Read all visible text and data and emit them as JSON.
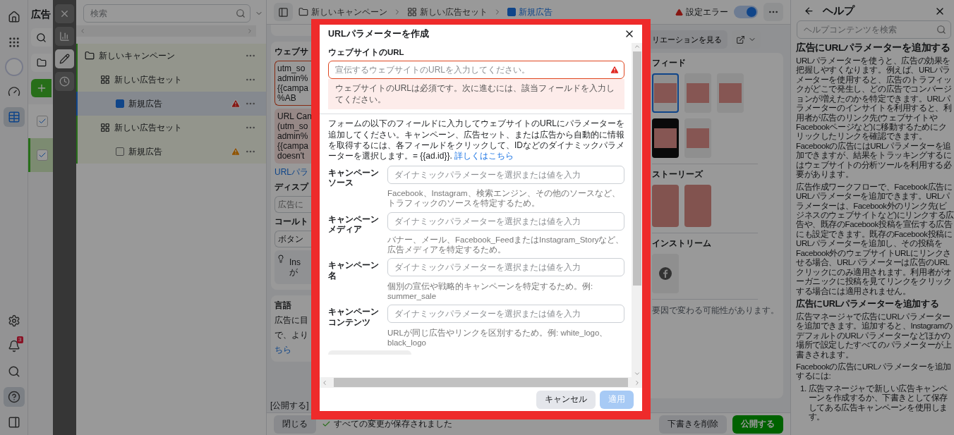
{
  "nav_rail": {
    "items": [
      {
        "kind": "home",
        "selected": false
      },
      {
        "kind": "apps",
        "selected": false
      },
      {
        "kind": "account",
        "selected": false
      },
      {
        "kind": "dashboard",
        "selected": false
      },
      {
        "kind": "table",
        "selected": true
      }
    ],
    "bottom_items": [
      {
        "kind": "settings",
        "selected": false
      },
      {
        "kind": "notifications",
        "selected": false,
        "badge": "3"
      },
      {
        "kind": "search",
        "selected": false
      },
      {
        "kind": "help",
        "selected": true
      },
      {
        "kind": "panel",
        "selected": false
      }
    ]
  },
  "side_panel": {
    "title": "広告",
    "rows": [
      {
        "checked": true,
        "selected": false
      },
      {
        "checked": true,
        "selected": true
      }
    ]
  },
  "tool_strip": {
    "items": [
      {
        "kind": "close",
        "selected": false
      },
      {
        "kind": "chart",
        "selected": false
      },
      {
        "kind": "edit",
        "selected": true
      },
      {
        "kind": "history",
        "selected": false
      }
    ]
  },
  "tree": {
    "search": {
      "placeholder": "検索"
    },
    "items": [
      {
        "kind": "campaign",
        "label": "新しいキャンペーン",
        "selected": false,
        "children": [
          {
            "kind": "ad_set",
            "label": "新しい広告セット",
            "selected": false,
            "children": [
              {
                "kind": "ad",
                "label": "新規広告",
                "selected": true,
                "error": true,
                "warning": false
              }
            ]
          },
          {
            "kind": "ad_set",
            "label": "新しい広告セット",
            "selected": false,
            "children": [
              {
                "kind": "ad",
                "label": "新規広告",
                "selected": false,
                "error": false,
                "warning": true
              }
            ]
          }
        ]
      }
    ]
  },
  "top_bar": {
    "breadcrumbs": [
      {
        "kind": "campaign",
        "label": "新しいキャンペーン",
        "selected": false
      },
      {
        "kind": "ad_set",
        "label": "新しい広告セット",
        "selected": false
      },
      {
        "kind": "ad",
        "label": "新規広告",
        "selected": true
      }
    ],
    "status": "設定エラー",
    "toggle_on": true
  },
  "editor": {
    "website_label": "ウェブサ",
    "url_box_lines": [
      "utm_so",
      "admin%",
      "{{campa",
      "%AB"
    ],
    "url_error_lines": [
      "URL Can",
      "(utm_so",
      "admin%",
      "{{campa",
      "doesn't"
    ],
    "param_link": "URLパラ",
    "display_label": "ディスプ",
    "display_placeholder": "広告に",
    "cta_label": "コールト",
    "cta_value": "ボタン",
    "tip_lines": [
      "Ins",
      "が"
    ],
    "language_title": "言語",
    "language_lines": [
      "広告に目",
      "で、より"
    ],
    "language_link": "ちら"
  },
  "publish_note": "[公開する]",
  "footer": {
    "close": "閉じる",
    "saved": "すべての変更が保存されました",
    "delete_draft": "下書きを削除",
    "publish": "公開する"
  },
  "preview": {
    "variations_button": "リエーションを見る",
    "sections": [
      {
        "title": "フィード",
        "thumbnails": [
          {
            "kind": "feed",
            "selected": true
          },
          {
            "kind": "feed",
            "selected": false
          },
          {
            "kind": "feed",
            "selected": false
          },
          {
            "kind": "feed_dark",
            "selected": false
          },
          {
            "kind": "feed",
            "selected": false
          }
        ]
      },
      {
        "title": "ストーリーズ",
        "thumbnails": [
          {
            "kind": "story",
            "selected": false
          },
          {
            "kind": "story",
            "selected": false
          }
        ]
      },
      {
        "title": "インストリーム",
        "thumbnails": [
          {
            "kind": "instream",
            "selected": false
          }
        ]
      }
    ],
    "note": "要因で変わる可能性があります。"
  },
  "help": {
    "title": "ヘルプ",
    "search": {
      "placeholder": "ヘルプコンテンツを検索"
    },
    "blocks": [
      {
        "kind": "heading",
        "text": "広告にURLパラメーターを追加する"
      },
      {
        "kind": "paragraph",
        "text": "URLパラメーターを使うと、広告の効果を把握しやすくなります。例えば、URLパラメーターを使用すると、広告のトラフィックがどこで発生し、どの広告でコンバージョンが増えたのかを特定できます。URLパラメーターのインサイトを利用すると、利用者が広告のリンク先(ウェブサイトやFacebookページなど)に移動するためにクリックしたリンクを確認できます。Facebookの広告にはURLパラメーターを追加できますが、結果をトラッキングするにはウェブサイトの分析ツールを利用する必要があります。"
      },
      {
        "kind": "paragraph",
        "text": "広告作成ワークフローで、Facebook広告にURLパラメーターを追加できます。URLパラメーターは、Facebook外のリンク先(ビジネスのウェブサイトなど)にリンクする広告や、既存のFacebook投稿を宣伝する広告にも設定できます。既存のFacebook投稿にURLパラメーターを追加し、その投稿をFacebook外のウェブサイトURLにリンクさせる場合、URLパラメーターは広告のURLクリックにのみ適用されます。利用者がオーガニックに投稿を見てリンクをクリックする場合には適用されません。"
      },
      {
        "kind": "subheading",
        "text": "広告にURLパラメーターを追加する"
      },
      {
        "kind": "paragraph",
        "text": "広告マネージャで広告にURLパラメーターを追加できます。追加すると、InstagramのデフォルトのURLパラメーターなどほかの場所で設定したすべてのパラメーターが上書きされます。"
      },
      {
        "kind": "paragraph",
        "text": "Facebookの広告にURLパラメーターを追加するには:"
      },
      {
        "kind": "list_item",
        "marker": "1.",
        "text": "広告マネージャで新しい広告キャンペーンを作成するか、下書きとして保存してある広告キャンペーンを使用します。"
      }
    ]
  },
  "dialog": {
    "title": "URLパラメーターを作成",
    "url_field": {
      "label": "ウェブサイトのURL",
      "placeholder": "宣伝するウェブサイトのURLを入力してください。",
      "error": true,
      "error_message": "ウェブサイトのURLは必須です。次に進むには、該当フィールドを入力してください。"
    },
    "description": "フォームの以下のフィールドに入力してウェブサイトのURLにパラメーターを追加してください。キャンペーン、広告セット、または広告から自動的に情報を取得するには、各フィールドをクリックして、IDなどのダイナミックパラメーターを選択します。= {{ad.id}}.",
    "link": "詳しくはこちら",
    "fields": [
      {
        "label": "キャンペーンソース",
        "placeholder": "ダイナミックパラメーターを選択または値を入力",
        "hint": "Facebook、Instagram、検索エンジン、その他のソースなど、トラフィックのソースを特定するため。"
      },
      {
        "label": "キャンペーンメディア",
        "placeholder": "ダイナミックパラメーターを選択または値を入力",
        "hint": "バナー、メール、Facebook_FeedまたはInstagram_Storyなど、広告メディアを特定するため。"
      },
      {
        "label": "キャンペーン名",
        "placeholder": "ダイナミックパラメーターを選択または値を入力",
        "hint": "個別の宣伝や戦略的キャンペーンを特定するため。例: summer_sale"
      },
      {
        "label": "キャンペーンコンテンツ",
        "placeholder": "ダイナミックパラメーターを選択または値を入力",
        "hint": "URLが同じ広告やリンクを区別するため。例: white_logo、black_logo"
      }
    ],
    "buttons": [
      {
        "kind": "secondary",
        "label": "キャンセル",
        "disabled": false
      },
      {
        "kind": "primary",
        "label": "適用",
        "disabled": true
      }
    ]
  }
}
